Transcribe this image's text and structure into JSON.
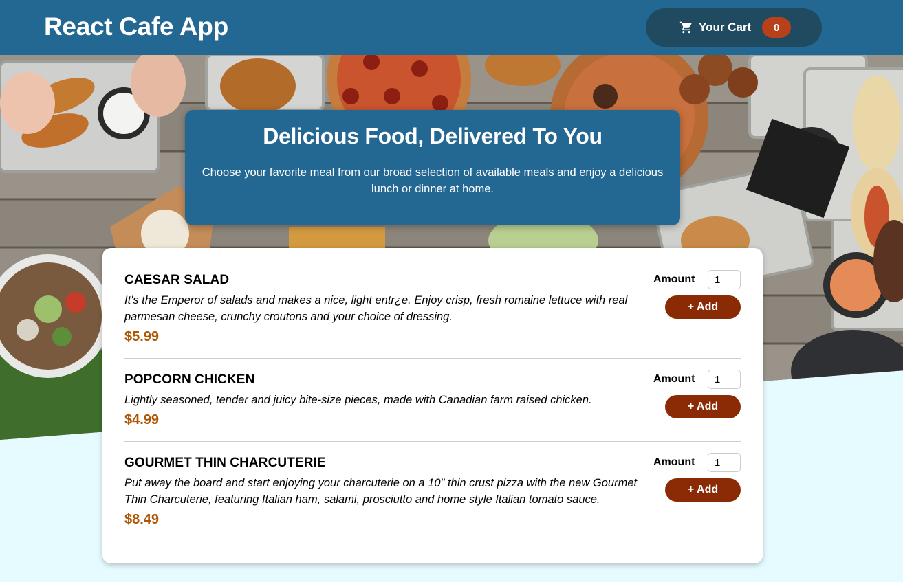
{
  "header": {
    "title": "React Cafe App",
    "cart_label": "Your Cart",
    "cart_count": "0"
  },
  "summary": {
    "title": "Delicious Food, Delivered To You",
    "text": "Choose your favorite meal from our broad selection of available meals and enjoy a delicious lunch or dinner at home."
  },
  "meals": [
    {
      "name": "CAESAR SALAD",
      "description": "It's the Emperor of salads and makes a nice, light entr¿e. Enjoy crisp, fresh romaine lettuce with real parmesan cheese, crunchy croutons and your choice of dressing.",
      "price": "$5.99",
      "amount_label": "Amount",
      "amount_value": "1",
      "add_label": "+ Add"
    },
    {
      "name": "POPCORN CHICKEN",
      "description": "Lightly seasoned, tender and juicy bite-size pieces, made with Canadian farm raised chicken.",
      "price": "$4.99",
      "amount_label": "Amount",
      "amount_value": "1",
      "add_label": "+ Add"
    },
    {
      "name": "GOURMET THIN CHARCUTERIE",
      "description": "Put away the board and start enjoying your charcuterie on a 10\" thin crust pizza with the new Gourmet Thin Charcuterie, featuring Italian ham, salami, prosciutto and home style Italian tomato sauce.",
      "price": "$8.49",
      "amount_label": "Amount",
      "amount_value": "1",
      "add_label": "+ Add"
    }
  ],
  "colors": {
    "header_bg": "#236793",
    "cart_bg": "#1f4a5f",
    "badge_bg": "#b8411c",
    "add_button_bg": "#8a2b06",
    "price": "#ad5502",
    "page_bg": "#e6fbff"
  },
  "icons": {
    "cart": "cart-icon"
  }
}
